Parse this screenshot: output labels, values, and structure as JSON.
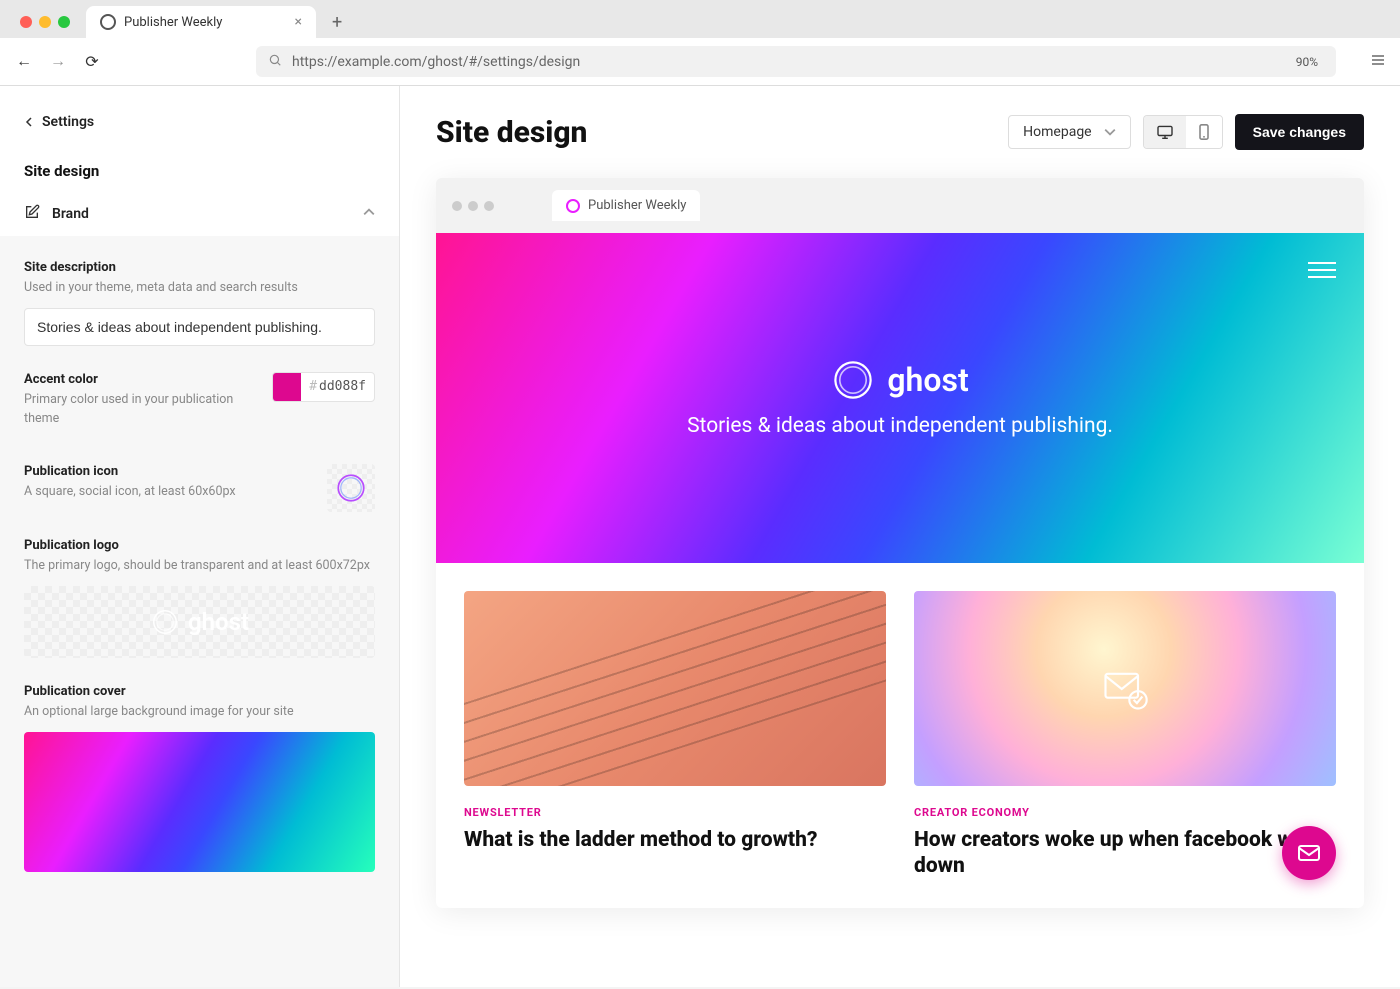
{
  "browser": {
    "tab_title": "Publisher Weekly",
    "url": "https://example.com/ghost/#/settings/design",
    "zoom": "90%"
  },
  "sidebar": {
    "back_label": "Settings",
    "title": "Site design",
    "section_brand": "Brand",
    "fields": {
      "site_description": {
        "label": "Site description",
        "help": "Used in your theme, meta data and search results",
        "value": "Stories & ideas about independent publishing."
      },
      "accent_color": {
        "label": "Accent color",
        "help": "Primary color used in your publication theme",
        "value": "dd088f",
        "hex": "#dd088f"
      },
      "publication_icon": {
        "label": "Publication icon",
        "help": "A square, social icon, at least 60x60px"
      },
      "publication_logo": {
        "label": "Publication logo",
        "help": "The primary logo, should be transparent and at least 600x72px",
        "logo_text": "ghost"
      },
      "publication_cover": {
        "label": "Publication cover",
        "help": "An optional large background image for your site"
      }
    }
  },
  "main": {
    "title": "Site design",
    "page_selector": "Homepage",
    "save_button": "Save changes"
  },
  "preview": {
    "tab_title": "Publisher Weekly",
    "hero_logo_text": "ghost",
    "hero_tagline": "Stories & ideas about independent publishing.",
    "cards": [
      {
        "tag": "NEWSLETTER",
        "title": "What is the ladder method to growth?"
      },
      {
        "tag": "CREATOR ECONOMY",
        "title": "How creators woke up when facebook went down"
      }
    ]
  }
}
